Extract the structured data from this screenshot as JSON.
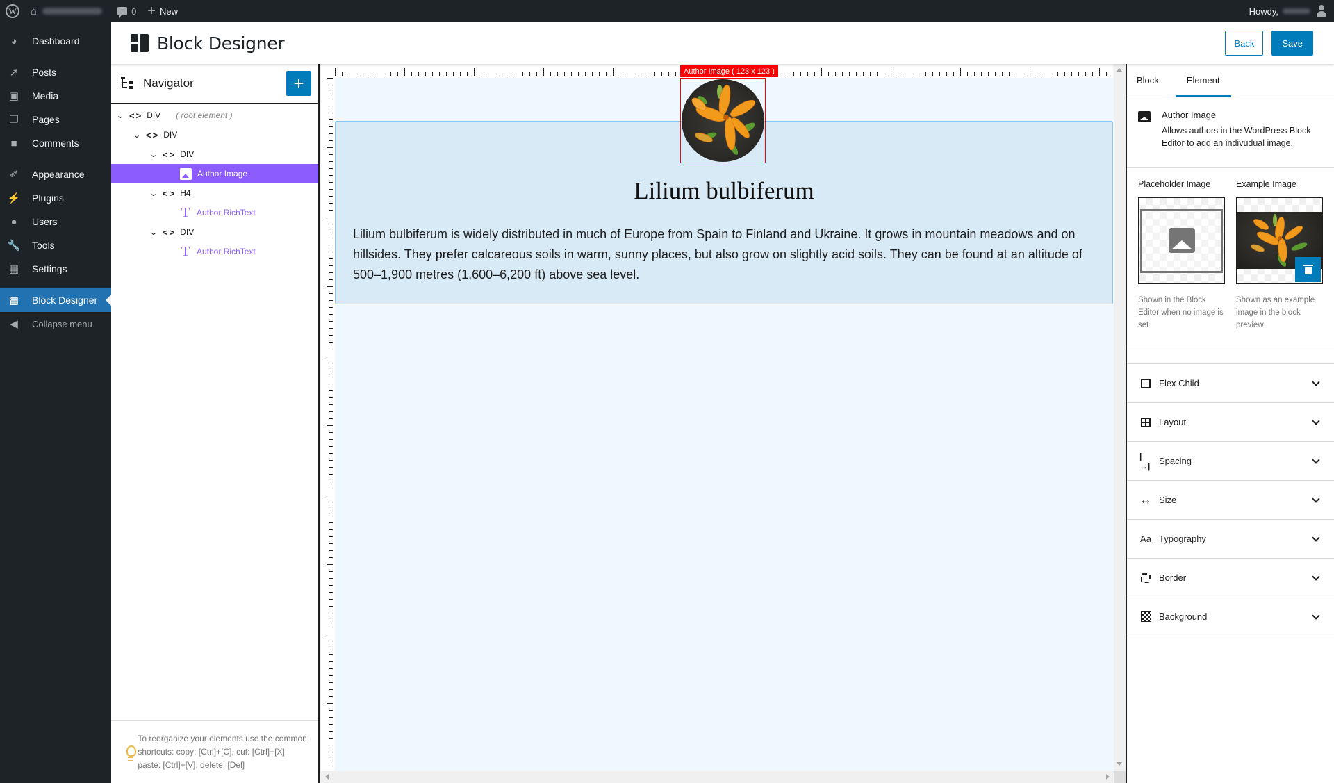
{
  "adminbar": {
    "comments_count": "0",
    "new_label": "New",
    "howdy_label": "Howdy,"
  },
  "sidebar": {
    "items": [
      {
        "label": "Dashboard",
        "icon": "dashboard-icon"
      },
      {
        "label": "Posts",
        "icon": "pin-icon"
      },
      {
        "label": "Media",
        "icon": "media-icon"
      },
      {
        "label": "Pages",
        "icon": "pages-icon"
      },
      {
        "label": "Comments",
        "icon": "comment-icon"
      },
      {
        "label": "Appearance",
        "icon": "paintbrush-icon"
      },
      {
        "label": "Plugins",
        "icon": "plugin-icon"
      },
      {
        "label": "Users",
        "icon": "users-icon"
      },
      {
        "label": "Tools",
        "icon": "wrench-icon"
      },
      {
        "label": "Settings",
        "icon": "settings-icon"
      },
      {
        "label": "Block Designer",
        "icon": "block-designer-icon",
        "current": true
      },
      {
        "label": "Collapse menu",
        "icon": "collapse-icon"
      }
    ]
  },
  "header": {
    "title": "Block Designer",
    "back_label": "Back",
    "save_label": "Save"
  },
  "navigator": {
    "title": "Navigator",
    "add_label": "+",
    "tree": [
      {
        "tag": "DIV",
        "note": "( root element )",
        "depth": 0
      },
      {
        "tag": "DIV",
        "depth": 1
      },
      {
        "tag": "DIV",
        "depth": 2
      },
      {
        "label": "Author Image",
        "type": "image",
        "depth": 3,
        "selected": true
      },
      {
        "tag": "H4",
        "depth": 2
      },
      {
        "label": "Author RichText",
        "type": "richtext",
        "depth": 3
      },
      {
        "tag": "DIV",
        "depth": 2
      },
      {
        "label": "Author RichText",
        "type": "richtext",
        "depth": 3
      }
    ],
    "tip": "To reorganize your elements use the common shortcuts: copy: [Ctrl]+[C], cut: [Ctrl]+[X], paste: [Ctrl]+[V], delete: [Del]"
  },
  "canvas": {
    "selection_label": "Author Image ( 123 x 123 )",
    "heading": "Lilium bulbiferum",
    "paragraph": "Lilium bulbiferum is widely distributed in much of Europe from Spain to Finland and Ukraine. It grows in mountain meadows and on hillsides. They prefer calcareous soils in warm, sunny places, but also grow on slightly acid soils. They can be found at an altitude of 500–1,900 metres (1,600–6,200 ft) above sea level."
  },
  "inspector": {
    "tabs": [
      {
        "label": "Block",
        "active": false
      },
      {
        "label": "Element",
        "active": true
      }
    ],
    "element": {
      "title": "Author Image",
      "description": "Allows authors in the WordPress Block Editor to add an indivudual image."
    },
    "placeholder_image": {
      "label": "Placeholder Image",
      "hint": "Shown in the Block Editor when no image is set"
    },
    "example_image": {
      "label": "Example Image",
      "hint": "Shown as an example image in the block preview"
    },
    "sections": [
      {
        "label": "Flex Child",
        "icon": "flex-child-icon"
      },
      {
        "label": "Layout",
        "icon": "layout-grid-icon"
      },
      {
        "label": "Spacing",
        "icon": "spacing-icon"
      },
      {
        "label": "Size",
        "icon": "size-icon"
      },
      {
        "label": "Typography",
        "icon": "typography-icon"
      },
      {
        "label": "Border",
        "icon": "border-icon"
      },
      {
        "label": "Background",
        "icon": "background-icon"
      }
    ]
  },
  "colors": {
    "admin_dark": "#1d2327",
    "wp_blue": "#2271b1",
    "button_blue": "#007cba",
    "selected_purple": "#8c5cff",
    "selection_red": "#ff0000",
    "canvas_bg": "#f0f8ff",
    "block_bg": "#d9eaf7"
  }
}
